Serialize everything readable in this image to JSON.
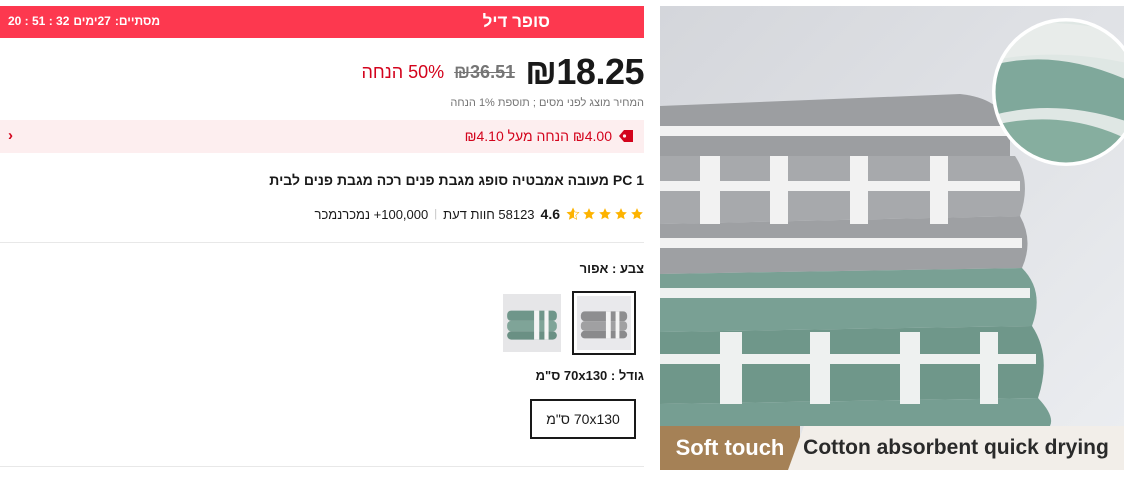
{
  "deal": {
    "title": "סופר דיל",
    "timer_label": "מסתיים:",
    "timer_days": "27ימים",
    "timer_value": "20 : 51 : 32"
  },
  "price": {
    "current": "₪18.25",
    "original": "₪36.51",
    "discount": "50% הנחה",
    "tax_note": "המחיר מוצג לפני מסים ; תוספת 1% הנחה"
  },
  "coupon": {
    "text": "₪4.00 הנחה מעל ₪4.10",
    "icon": "tag-icon"
  },
  "product": {
    "title": "1 PC מעובה אמבטיה סופג מגבת פנים רכה מגבת פנים לבית",
    "rating": "4.6",
    "reviews": "58123 חוות דעת",
    "sold": "100,000+ נמכרנמכר",
    "stars": 4.6
  },
  "options": {
    "color_label": "צבע : אפור",
    "colors": [
      "אפור",
      "ירוק"
    ],
    "size_label": "גודל : 70x130 ס\"מ",
    "size_value": "70x130 ס\"מ"
  },
  "image": {
    "caption_left": "Soft touch",
    "caption_right": "Cotton absorbent quick drying"
  },
  "colors": {
    "accent": "#fd384f",
    "discount": "#d3031c",
    "coupon_bg": "#fdeeef",
    "star": "#fdb300"
  }
}
